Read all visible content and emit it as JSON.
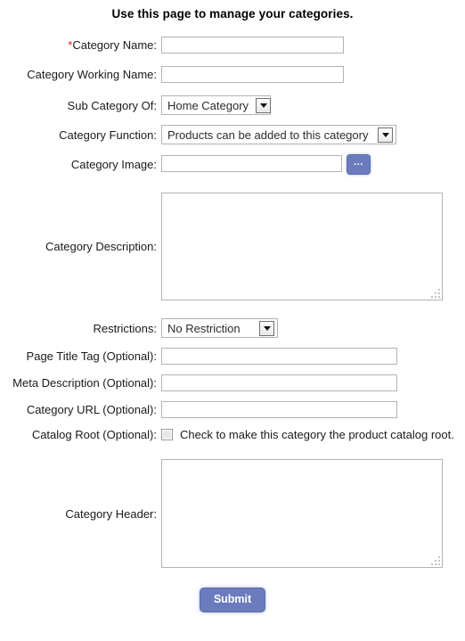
{
  "page": {
    "heading": "Use this page to manage your categories."
  },
  "form": {
    "fields": {
      "category_name": {
        "label": "Category Name:",
        "required_marker": "*",
        "value": "",
        "placeholder": ""
      },
      "category_working_name": {
        "label": "Category Working Name:",
        "value": "",
        "placeholder": ""
      },
      "sub_category_of": {
        "label": "Sub Category Of:",
        "selected": "Home Category"
      },
      "category_function": {
        "label": "Category Function:",
        "selected": "Products can be added to this category"
      },
      "category_image": {
        "label": "Category Image:",
        "value": "",
        "placeholder": "",
        "browse_label": "..."
      },
      "category_description": {
        "label": "Category Description:",
        "value": "",
        "placeholder": ""
      },
      "restrictions": {
        "label": "Restrictions:",
        "selected": "No Restriction"
      },
      "page_title_tag": {
        "label": "Page Title Tag (Optional):",
        "value": "",
        "placeholder": ""
      },
      "meta_description": {
        "label": "Meta Description (Optional):",
        "value": "",
        "placeholder": ""
      },
      "category_url": {
        "label": "Category URL (Optional):",
        "value": "",
        "placeholder": ""
      },
      "catalog_root": {
        "label": "Catalog Root (Optional):",
        "checkbox_text": "Check to make this category the product catalog root.",
        "checked": false
      },
      "category_header": {
        "label": "Category Header:",
        "value": "",
        "placeholder": ""
      }
    },
    "submit": {
      "label": "Submit"
    }
  },
  "colors": {
    "accent": "#6b7cbe",
    "required": "#e02020",
    "field_border": "#b3b3b3",
    "text": "#1a1a1a"
  }
}
